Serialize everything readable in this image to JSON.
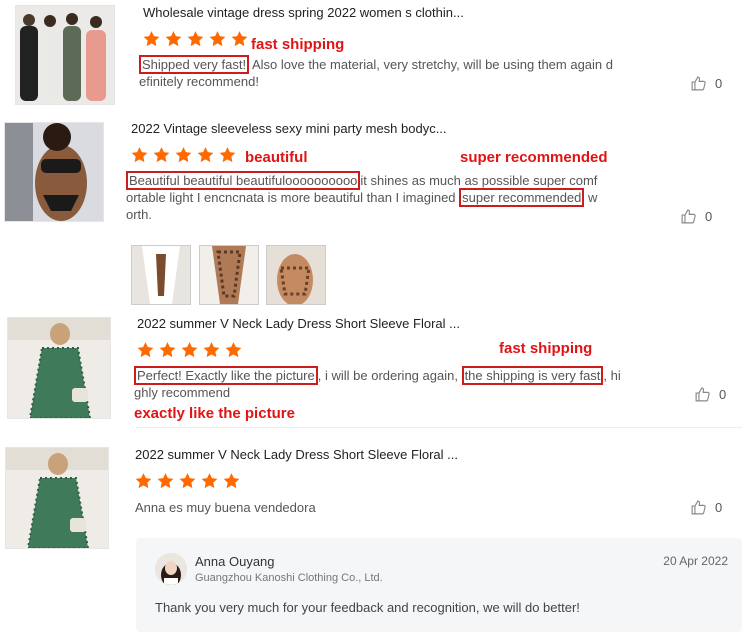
{
  "reviews": [
    {
      "title": "Wholesale vintage dress spring 2022 women s clothin...",
      "stars": 5,
      "text_highlight_1": "Shipped very fast!",
      "text_rest_1": " Also love the material, very stretchy, will be using them again d",
      "text_line_2": "efinitely recommend!",
      "annotation_1": "fast shipping",
      "likes": "0"
    },
    {
      "title": "2022 Vintage sleeveless sexy mini party mesh bodyc...",
      "stars": 5,
      "text_highlight_1": "Beautiful beautiful beautifuloooooooooo",
      "text_rest_1": "it shines as much as possible super comf",
      "text_line_2": "ortable light I encncnata is more beautiful than I imagined ",
      "text_highlight_2": "super recommended",
      "text_rest_2": " w",
      "text_line_3": "orth.",
      "annotation_1": "beautiful",
      "annotation_2": "super recommended",
      "likes": "0"
    },
    {
      "title": "2022 summer V Neck Lady Dress Short Sleeve Floral ...",
      "stars": 5,
      "text_highlight_1": "Perfect! Exactly like the picture",
      "text_rest_1": ", i will be ordering again, ",
      "text_highlight_2": "the shipping is very fast",
      "text_rest_2": ", hi",
      "text_line_2": "ghly recommend",
      "annotation_1": "exactly like the picture",
      "annotation_2": "fast shipping",
      "likes": "0"
    },
    {
      "title": "2022 summer V Neck Lady Dress Short Sleeve Floral ...",
      "stars": 5,
      "text": "Anna es muy buena vendedora",
      "likes": "0"
    }
  ],
  "seller_reply": {
    "name": "Anna Ouyang",
    "company": "Guangzhou Kanoshi Clothing Co., Ltd.",
    "date": "20 Apr 2022",
    "message": "Thank you very much for your feedback and recognition, we will do better!"
  },
  "colors": {
    "star": "#ff6a00",
    "annotation": "#e01414",
    "highlight_border": "#cc1c1c"
  }
}
